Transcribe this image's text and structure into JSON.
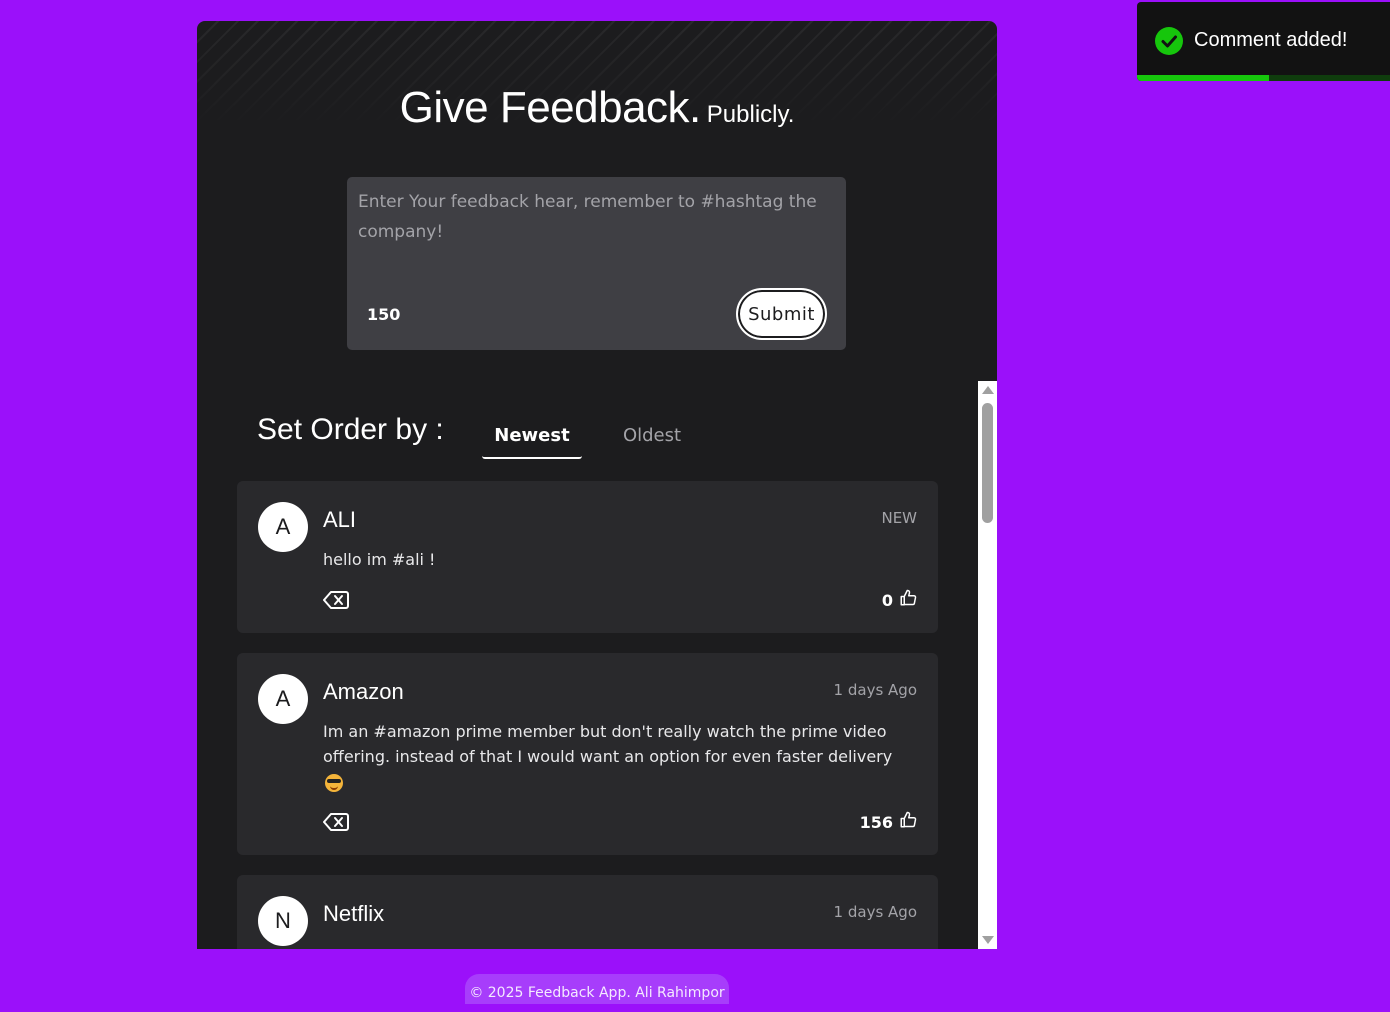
{
  "header": {
    "title_main": "Give Feedback.",
    "title_sub": "Publicly."
  },
  "form": {
    "placeholder": "Enter Your feedback hear, remember to #hashtag the company!",
    "value": "",
    "char_count": "150",
    "submit_label": "Submit"
  },
  "order": {
    "label": "Set Order by :",
    "tabs": [
      {
        "label": "Newest",
        "active": true
      },
      {
        "label": "Oldest",
        "active": false
      }
    ]
  },
  "feedback": [
    {
      "initial": "A",
      "company": "ALI",
      "time": "NEW",
      "text": "hello im #ali !",
      "upvotes": "0"
    },
    {
      "initial": "A",
      "company": "Amazon",
      "time": "1 days Ago",
      "text": "Im an #amazon prime member but don't really watch the prime video offering. instead of that I would want an option for even faster delivery",
      "emoji": "smiling-face-with-sunglasses",
      "upvotes": "156"
    },
    {
      "initial": "N",
      "company": "Netflix",
      "time": "1 days Ago",
      "text": "",
      "upvotes": ""
    }
  ],
  "footer": {
    "text": "© 2025 Feedback App. Ali Rahimpor"
  },
  "toast": {
    "message": "Comment added!",
    "progress": 0.52,
    "color": "#16c60c"
  },
  "colors": {
    "background": "#9b10fa",
    "panel": "#1c1c1e",
    "card": "#29292c",
    "input": "#3f3f44"
  }
}
